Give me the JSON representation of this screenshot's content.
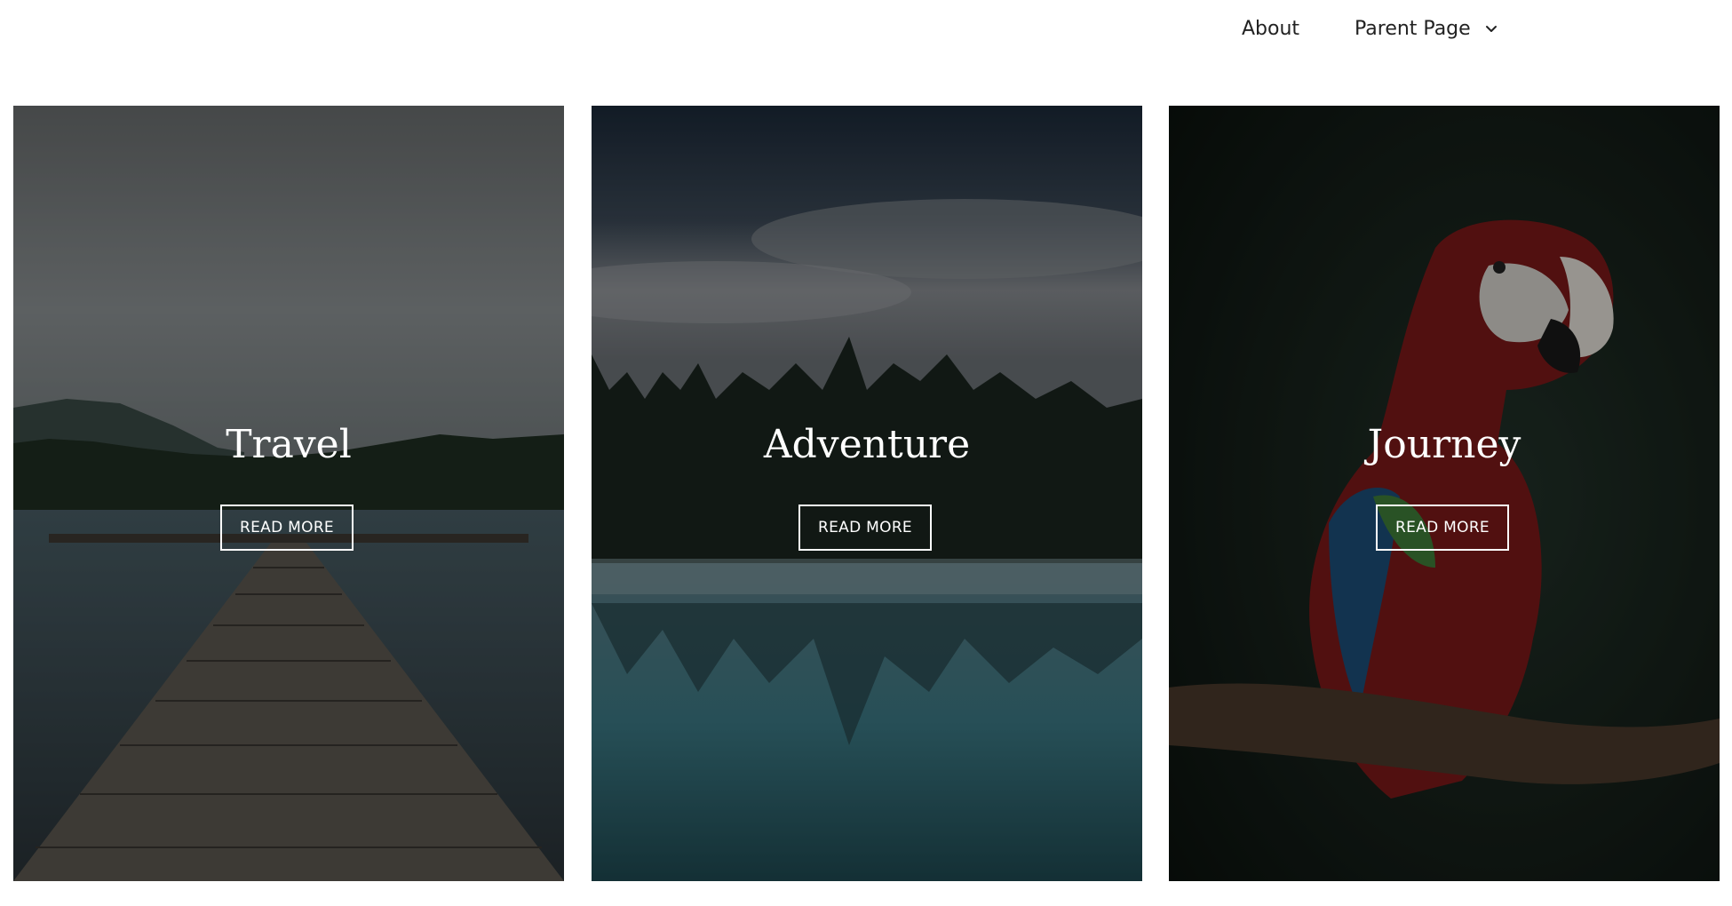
{
  "nav": {
    "about_label": "About",
    "parent_label": "Parent Page",
    "parent_dropdown_icon": "chevron-down-icon"
  },
  "cards": [
    {
      "title": "Travel",
      "button_label": "READ MORE",
      "image": "pier-lake-image"
    },
    {
      "title": "Adventure",
      "button_label": "READ MORE",
      "image": "forest-lake-image"
    },
    {
      "title": "Journey",
      "button_label": "READ MORE",
      "image": "parrot-image"
    }
  ],
  "colors": {
    "nav_text": "#222222",
    "card_text": "#ffffff",
    "button_border": "#ffffff"
  }
}
